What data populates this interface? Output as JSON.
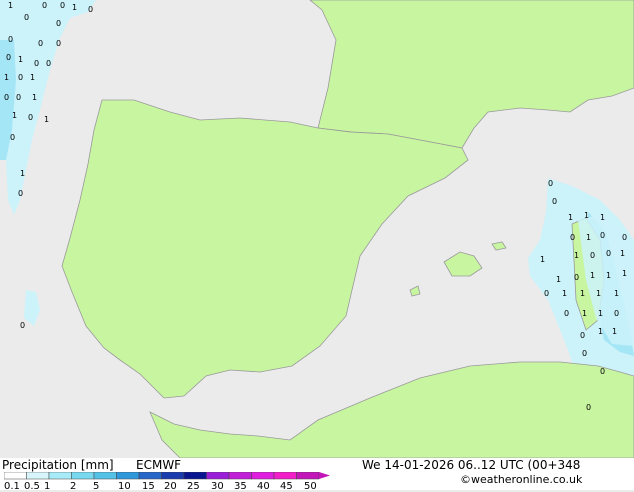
{
  "title": "Precipitation [mm]",
  "model": "ECMWF",
  "valid_time": "We 14-01-2026 06..12 UTC (00+348",
  "credit": "©weatheronline.co.uk",
  "legend": {
    "ticks": [
      "0.1",
      "0.5",
      "1",
      "2",
      "5",
      "10",
      "15",
      "20",
      "25",
      "30",
      "35",
      "40",
      "45",
      "50"
    ],
    "colors": [
      "#ffffff",
      "#d7f5fb",
      "#a8ebf8",
      "#78d8f0",
      "#54c2e6",
      "#2f98da",
      "#2566c8",
      "#1a3bae",
      "#0a1590",
      "#9b1fd8",
      "#c21fd8",
      "#e01ee0",
      "#f21ec8",
      "#c216b8"
    ]
  },
  "map": {
    "land_color": "#c8f5a0",
    "sea_color": "#ebebeb",
    "precip_light": "#ccf2fa",
    "precip_mid": "#a4e6f6",
    "marker_groups": [
      {
        "name": "atlantic-north",
        "values": [
          "1",
          "0",
          "0",
          "1",
          "0",
          "0",
          "0",
          "0",
          "0",
          "0",
          "0",
          "1",
          "0",
          "0",
          "1",
          "0",
          "1",
          "0",
          "0",
          "1",
          "1",
          "0",
          "1",
          "0",
          "1",
          "0",
          "0"
        ]
      },
      {
        "name": "mediterranean-east",
        "values": [
          "0",
          "0",
          "1",
          "1",
          "1",
          "0",
          "1",
          "0",
          "0",
          "1",
          "1",
          "0",
          "0",
          "1",
          "1",
          "0",
          "1",
          "1",
          "1",
          "0",
          "1",
          "1",
          "1",
          "1",
          "0",
          "1",
          "1",
          "0",
          "0",
          "1",
          "1",
          "0",
          "0",
          "0"
        ]
      }
    ]
  }
}
